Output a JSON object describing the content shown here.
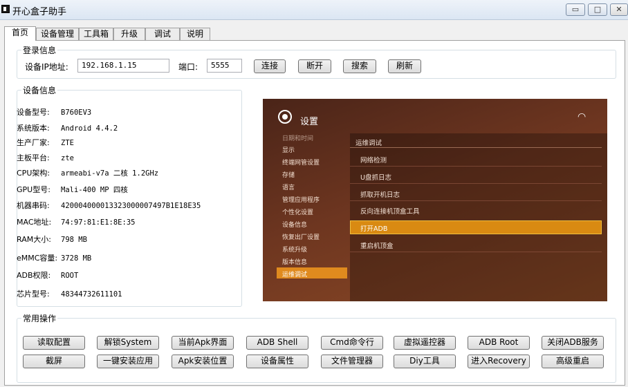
{
  "window": {
    "title": "开心盒子助手",
    "controls": {
      "minimize": "▭",
      "maximize": "□",
      "close": "✕"
    }
  },
  "tabs": [
    "首页",
    "设备管理",
    "工具箱",
    "升级",
    "调试",
    "说明"
  ],
  "login": {
    "group_title": "登录信息",
    "ip_label": "设备IP地址:",
    "ip_value": "192.168.1.15",
    "port_label": "端口:",
    "port_value": "5555",
    "buttons": [
      "连接",
      "断开",
      "搜索",
      "刷新"
    ]
  },
  "device_info": {
    "group_title": "设备信息",
    "rows": [
      {
        "key": "设备型号:",
        "value": "B760EV3"
      },
      {
        "key": "系统版本:",
        "value": "Android 4.4.2"
      },
      {
        "key": "生产厂家:",
        "value": "ZTE"
      },
      {
        "key": "主板平台:",
        "value": "zte"
      },
      {
        "key": "CPU架构:",
        "value": "armeabi-v7a 二核 1.2GHz"
      },
      {
        "key": "GPU型号:",
        "value": "Mali-400 MP 四核"
      },
      {
        "key": "机器串码:",
        "value": "420004000013323000007497B1E18E35"
      },
      {
        "key": "MAC地址:",
        "value": "74:97:81:E1:8E:35"
      },
      {
        "key": "RAM大小:",
        "value": "798 MB"
      },
      {
        "key": "eMMC容量:",
        "value": "3728 MB"
      },
      {
        "key": "ADB权限:",
        "value": "ROOT"
      },
      {
        "key": "芯片型号:",
        "value": "48344732611101"
      }
    ]
  },
  "screenshot": {
    "title": "设置",
    "menu": [
      "日期和时间",
      "显示",
      "终端网管设置",
      "存储",
      "语言",
      "管理应用程序",
      "个性化设置",
      "设备信息",
      "恢复出厂设置",
      "系统升级",
      "版本信息",
      "运维调试"
    ],
    "selected_menu_index": 11,
    "section_title": "运维调试",
    "items": [
      "网络检测",
      "U盘抓日志",
      "抓取开机日志",
      "反向连接机顶盒工具",
      "打开ADB",
      "重启机顶盒"
    ],
    "selected_item_index": 4,
    "wifi_glyph": "📶"
  },
  "ops": {
    "group_title": "常用操作",
    "row1": [
      "读取配置",
      "解锁System",
      "当前Apk界面",
      "ADB Shell",
      "Cmd命令行",
      "虚拟遥控器",
      "ADB  Root",
      "关闭ADB服务"
    ],
    "row2": [
      "截屏",
      "一键安装应用",
      "Apk安装位置",
      "设备属性",
      "文件管理器",
      "Diy工具",
      "进入Recovery",
      "高级重启"
    ]
  }
}
